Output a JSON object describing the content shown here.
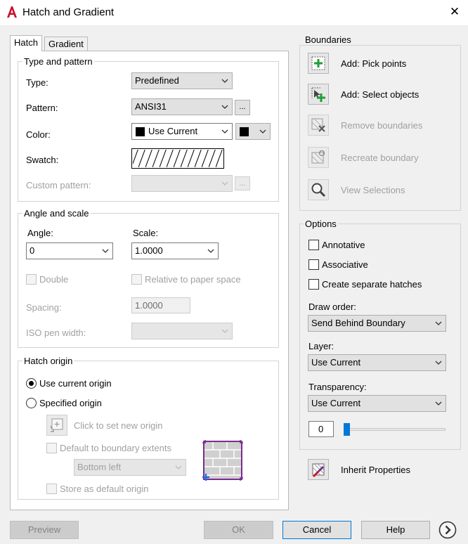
{
  "window": {
    "title": "Hatch and Gradient"
  },
  "tabs": [
    {
      "label": "Hatch"
    },
    {
      "label": "Gradient"
    }
  ],
  "type_pattern": {
    "title": "Type and pattern",
    "type_label": "Type:",
    "type_value": "Predefined",
    "pattern_label": "Pattern:",
    "pattern_value": "ANSI31",
    "color_label": "Color:",
    "color_value": "Use Current",
    "swatch_label": "Swatch:",
    "custom_pattern_label": "Custom pattern:",
    "browse": "..."
  },
  "angle_scale": {
    "title": "Angle and scale",
    "angle_label": "Angle:",
    "angle_value": "0",
    "scale_label": "Scale:",
    "scale_value": "1.0000",
    "double_label": "Double",
    "relative_label": "Relative to paper space",
    "spacing_label": "Spacing:",
    "spacing_value": "1.0000",
    "iso_label": "ISO pen width:"
  },
  "hatch_origin": {
    "title": "Hatch origin",
    "use_current": "Use current origin",
    "specified": "Specified origin",
    "click_to_set": "Click to set new origin",
    "default_extents": "Default to boundary extents",
    "position_value": "Bottom left",
    "store_default": "Store as default origin"
  },
  "boundaries": {
    "title": "Boundaries",
    "pick_points": "Add: Pick points",
    "select_objects": "Add: Select objects",
    "remove": "Remove boundaries",
    "recreate": "Recreate boundary",
    "view": "View Selections"
  },
  "options": {
    "title": "Options",
    "annotative": "Annotative",
    "associative": "Associative",
    "separate": "Create separate hatches",
    "draw_order_label": "Draw order:",
    "draw_order_value": "Send Behind Boundary",
    "layer_label": "Layer:",
    "layer_value": "Use Current",
    "transparency_label": "Transparency:",
    "transparency_value": "Use Current",
    "transparency_amount": "0",
    "inherit": "Inherit Properties"
  },
  "buttons": {
    "preview": "Preview",
    "ok": "OK",
    "cancel": "Cancel",
    "help": "Help"
  },
  "colors": {
    "accent": "#0078d7",
    "title_icon": "#c8102e",
    "add_green": "#1f9d3a",
    "swatch_frame": "#7b2c8f"
  }
}
